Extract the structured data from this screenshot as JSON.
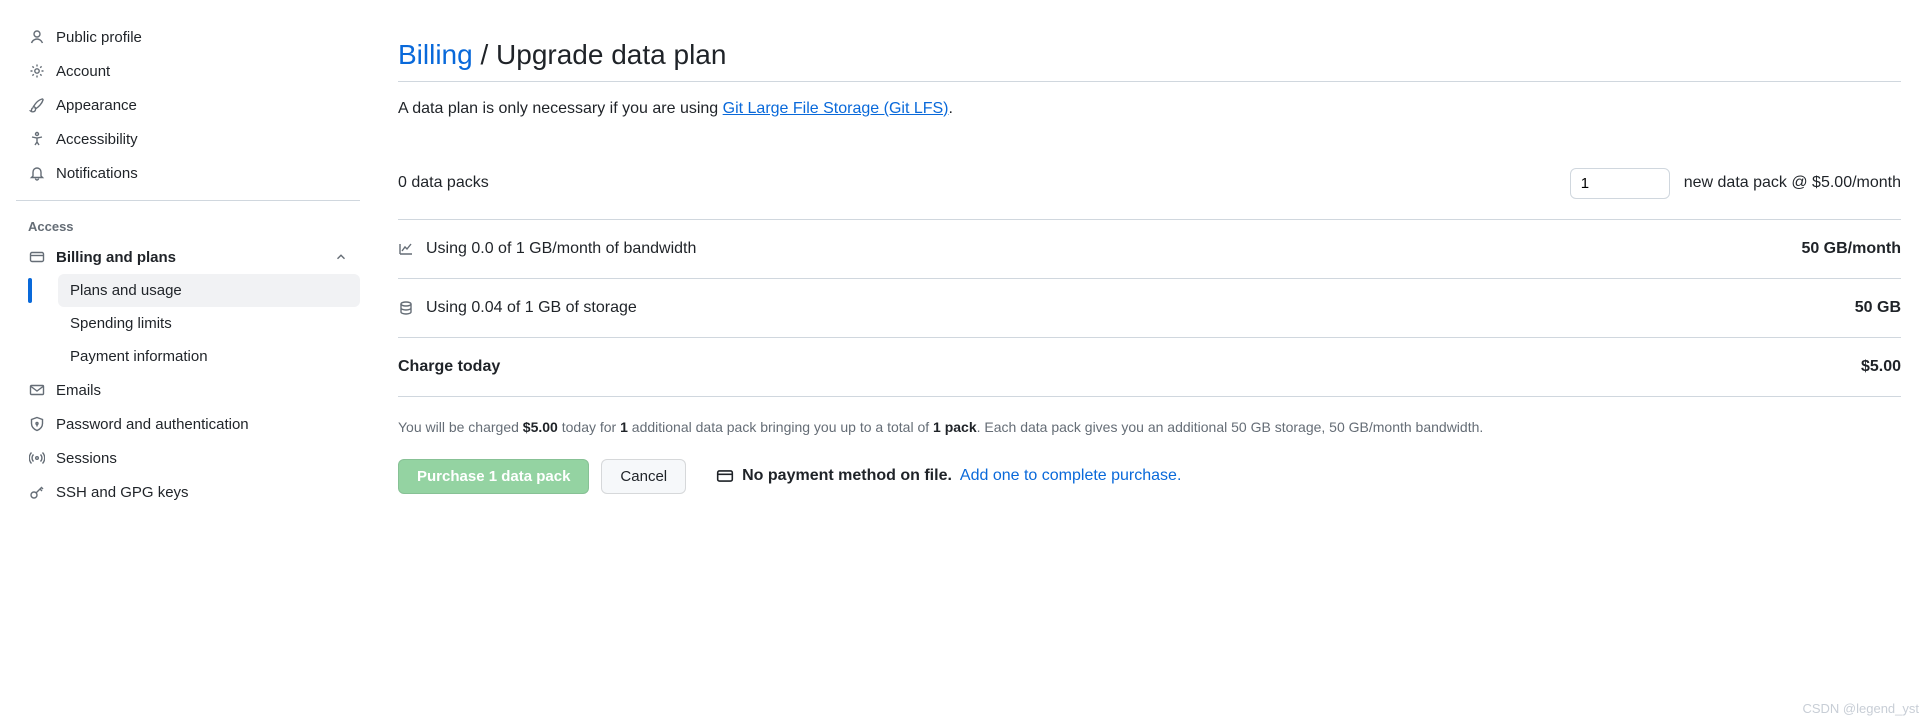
{
  "sidebar": {
    "top": [
      {
        "label": "Public profile"
      },
      {
        "label": "Account"
      },
      {
        "label": "Appearance"
      },
      {
        "label": "Accessibility"
      },
      {
        "label": "Notifications"
      }
    ],
    "access_header": "Access",
    "billing_label": "Billing and plans",
    "billing_children": [
      {
        "label": "Plans and usage"
      },
      {
        "label": "Spending limits"
      },
      {
        "label": "Payment information"
      }
    ],
    "rest": [
      {
        "label": "Emails"
      },
      {
        "label": "Password and authentication"
      },
      {
        "label": "Sessions"
      },
      {
        "label": "SSH and GPG keys"
      }
    ]
  },
  "header": {
    "crumb": "Billing",
    "sep": " / ",
    "title": "Upgrade data plan"
  },
  "description": {
    "prefix": "A data plan is only necessary if you are using ",
    "link": "Git Large File Storage (Git LFS)",
    "suffix": "."
  },
  "packs": {
    "current": "0 data packs",
    "input_value": "1",
    "rate": "new data pack @ $5.00/month"
  },
  "bandwidth": {
    "left": "Using 0.0 of 1 GB/month of bandwidth",
    "right": "50 GB/month"
  },
  "storage": {
    "left": "Using 0.04 of 1 GB of storage",
    "right": "50 GB"
  },
  "charge": {
    "label": "Charge today",
    "amount": "$5.00"
  },
  "fineprint": {
    "p1": "You will be charged ",
    "b1": "$5.00",
    "p2": " today for ",
    "b2": "1",
    "p3": " additional data pack bringing you up to a total of ",
    "b3": "1 pack",
    "p4": ". Each data pack gives you an additional 50 GB storage, 50 GB/month bandwidth."
  },
  "buttons": {
    "purchase": "Purchase 1 data pack",
    "cancel": "Cancel"
  },
  "nopay": {
    "strong": "No payment method on file.",
    "link": "Add one to complete purchase."
  },
  "watermark": "CSDN @legend_yst"
}
